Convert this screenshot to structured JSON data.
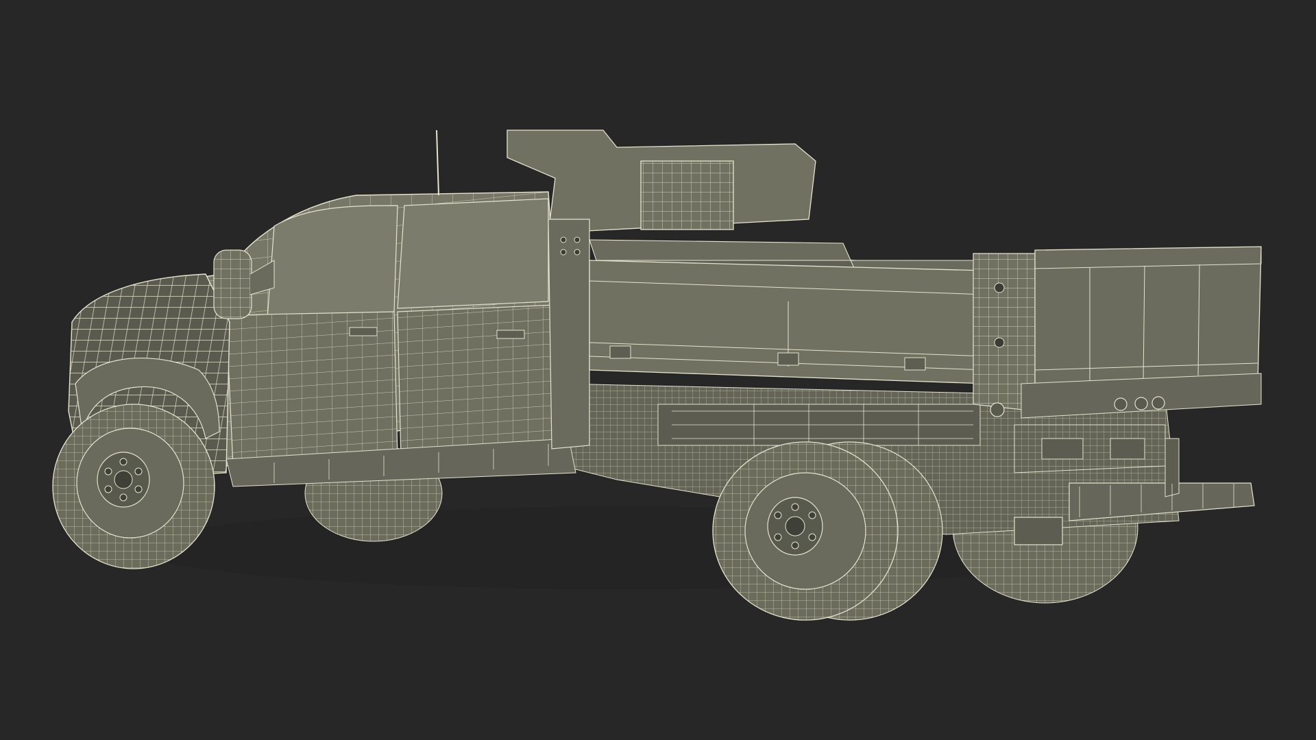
{
  "scene": {
    "subject": "truck-wireframe",
    "colors": {
      "background": "#272727",
      "surface": "#6f7060",
      "surface_light": "#7d7e6d",
      "surface_dark": "#55564a",
      "wire": "#e6e4cf",
      "shadow": "#3a3b33"
    }
  }
}
